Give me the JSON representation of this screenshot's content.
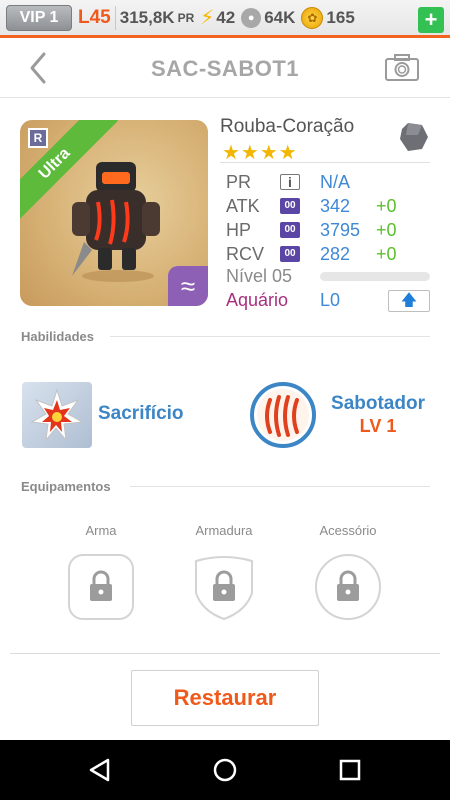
{
  "status": {
    "vip": "VIP 1",
    "level": "L45",
    "pr_value": "315,8K",
    "pr_unit": "PR",
    "energy": "42",
    "paws": "64K",
    "coins": "165",
    "plus": "+"
  },
  "header": {
    "title": "SAC-SABOT1"
  },
  "monster": {
    "name": "Rouba-Coração",
    "rarity": "Ultra",
    "rank_badge": "R",
    "stars": "★★★★",
    "stats": [
      {
        "label": "PR",
        "badge": "i",
        "value": "N/A",
        "bonus": ""
      },
      {
        "label": "ATK",
        "badge": "00",
        "value": "342",
        "bonus": "+0"
      },
      {
        "label": "HP",
        "badge": "00",
        "value": "3795",
        "bonus": "+0"
      },
      {
        "label": "RCV",
        "badge": "00",
        "value": "282",
        "bonus": "+0"
      }
    ],
    "level_label": "Nível 05",
    "level_progress": 0,
    "attribute": "Aquário",
    "attribute_level": "L0"
  },
  "skills": {
    "section_label": "Habilidades",
    "items": [
      {
        "name": "Sacrifício",
        "level": ""
      },
      {
        "name": "Sabotador",
        "level": "LV 1"
      }
    ]
  },
  "equipment": {
    "section_label": "Equipamentos",
    "slots": [
      {
        "label": "Arma"
      },
      {
        "label": "Armadura"
      },
      {
        "label": "Acessório"
      }
    ]
  },
  "actions": {
    "restore_label": "Restaurar"
  },
  "colors": {
    "accent": "#ef5a1c",
    "blue": "#3f88d6",
    "green": "#5cbf2c"
  }
}
